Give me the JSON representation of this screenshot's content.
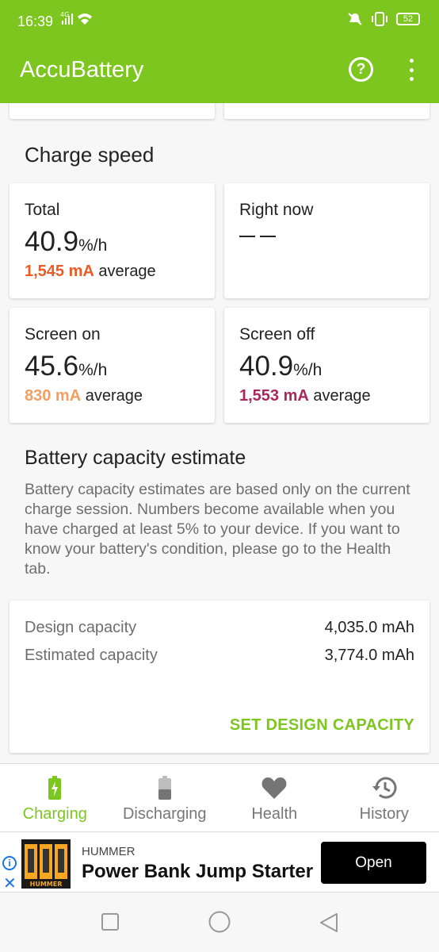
{
  "status_bar": {
    "time": "16:39",
    "network": "4G",
    "battery": "52"
  },
  "app_bar": {
    "title": "AccuBattery"
  },
  "charge_speed": {
    "title": "Charge speed",
    "total": {
      "label": "Total",
      "value": "40.9",
      "unit": "%/h",
      "current": "1,545 mA",
      "suffix": "average"
    },
    "right_now": {
      "label": "Right now"
    },
    "screen_on": {
      "label": "Screen on",
      "value": "45.6",
      "unit": "%/h",
      "current": "830 mA",
      "suffix": "average"
    },
    "screen_off": {
      "label": "Screen off",
      "value": "40.9",
      "unit": "%/h",
      "current": "1,553 mA",
      "suffix": "average"
    }
  },
  "capacity": {
    "title": "Battery capacity estimate",
    "description": "Battery capacity estimates are based only on the current charge session. Numbers become available when you have charged at least 5% to your device. If you want to know your battery's condition, please go to the Health tab.",
    "design_label": "Design capacity",
    "design_value": "4,035.0 mAh",
    "estimated_label": "Estimated capacity",
    "estimated_value": "3,774.0 mAh",
    "set_button": "SET DESIGN CAPACITY"
  },
  "bottom_nav": [
    {
      "label": "Charging",
      "icon": "battery-charging-icon",
      "active": true
    },
    {
      "label": "Discharging",
      "icon": "battery-discharging-icon",
      "active": false
    },
    {
      "label": "Health",
      "icon": "heart-icon",
      "active": false
    },
    {
      "label": "History",
      "icon": "history-icon",
      "active": false
    }
  ],
  "ad": {
    "brand": "HUMMER",
    "title": "Power Bank Jump Starter",
    "button": "Open",
    "image_text": "HUMMER"
  },
  "colors": {
    "accent": "#7cc61f",
    "total_current": "#ee5a24",
    "screen_on_current": "#f0a064",
    "screen_off_current": "#a8285c"
  }
}
